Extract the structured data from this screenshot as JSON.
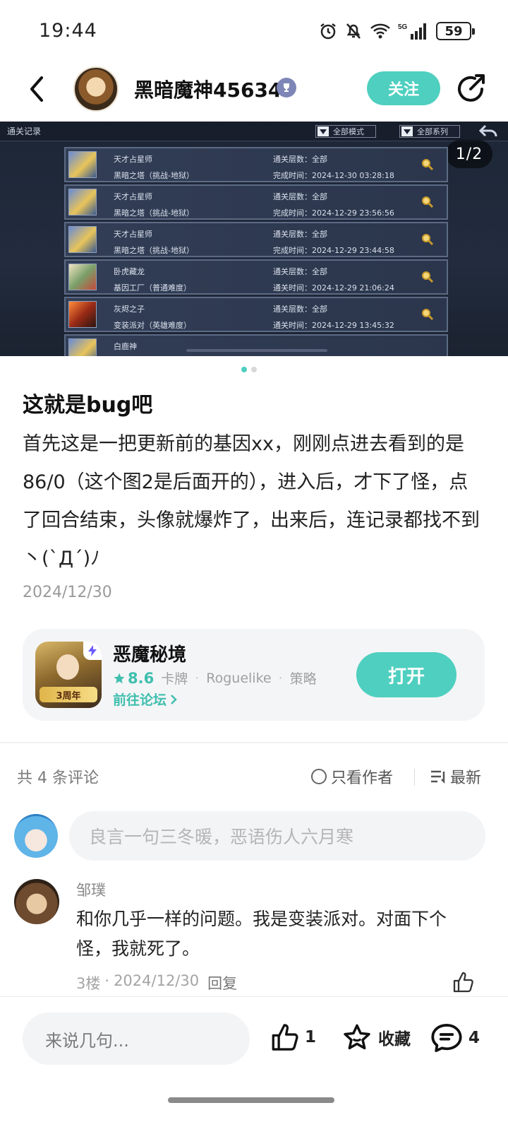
{
  "status_bar": {
    "time": "19:44",
    "battery": "59"
  },
  "header": {
    "username": "黑暗魔神45634",
    "follow_label": "关注"
  },
  "image": {
    "panel_title": "通关记录",
    "filter_mode": "全部模式",
    "filter_series": "全部系列",
    "counter": "1/2",
    "records": [
      {
        "name": "天才占星师",
        "mode": "黑暗之塔（挑战-地狱）",
        "floors": "通关层数：全部",
        "time": "完成时间：2024-12-30 03:28:18"
      },
      {
        "name": "天才占星师",
        "mode": "黑暗之塔（挑战-地狱）",
        "floors": "通关层数：全部",
        "time": "完成时间：2024-12-29 23:56:56"
      },
      {
        "name": "天才占星师",
        "mode": "黑暗之塔（挑战-地狱）",
        "floors": "通关层数：全部",
        "time": "完成时间：2024-12-29 23:44:58"
      },
      {
        "name": "卧虎藏龙",
        "mode": "基因工厂（普通难度）",
        "floors": "通关层数：全部",
        "time": "通关时间：2024-12-29 21:06:24"
      },
      {
        "name": "灰烬之子",
        "mode": "变装派对（英雄难度）",
        "floors": "通关层数：全部",
        "time": "通关时间：2024-12-29 13:45:32"
      },
      {
        "name": "白鹿神",
        "mode": "",
        "floors": "",
        "time": ""
      }
    ]
  },
  "post": {
    "title": "这就是bug吧",
    "body": "首先这是一把更新前的基因xx，刚刚点进去看到的是86/0（这个图2是后面开的），进入后，才下了怪，点了回合结束，头像就爆炸了，出来后，连记录都找不到丶(`Д´)ﾉ",
    "date": "2024/12/30"
  },
  "app_card": {
    "name": "恶魔秘境",
    "rating": "8.6",
    "tags": [
      "卡牌",
      "Roguelike",
      "策略"
    ],
    "forum_link": "前往论坛",
    "open_label": "打开",
    "icon_label": "3周年"
  },
  "comments": {
    "count_label": "共 4 条评论",
    "only_author": "只看作者",
    "sort": "最新",
    "input_placeholder": "良言一句三冬暖，恶语伤人六月寒",
    "items": [
      {
        "author": "邹璞",
        "text": "和你几乎一样的问题。我是变装派对。对面下个怪，我就死了。",
        "floor": "3楼",
        "date": "2024/12/30",
        "reply": "回复"
      }
    ]
  },
  "bottom_bar": {
    "placeholder": "来说几句...",
    "likes": "1",
    "favorite_label": "收藏",
    "comment_count": "4"
  },
  "colors": {
    "accent": "#4fcfbf",
    "accent_text": "#3fbfae"
  }
}
